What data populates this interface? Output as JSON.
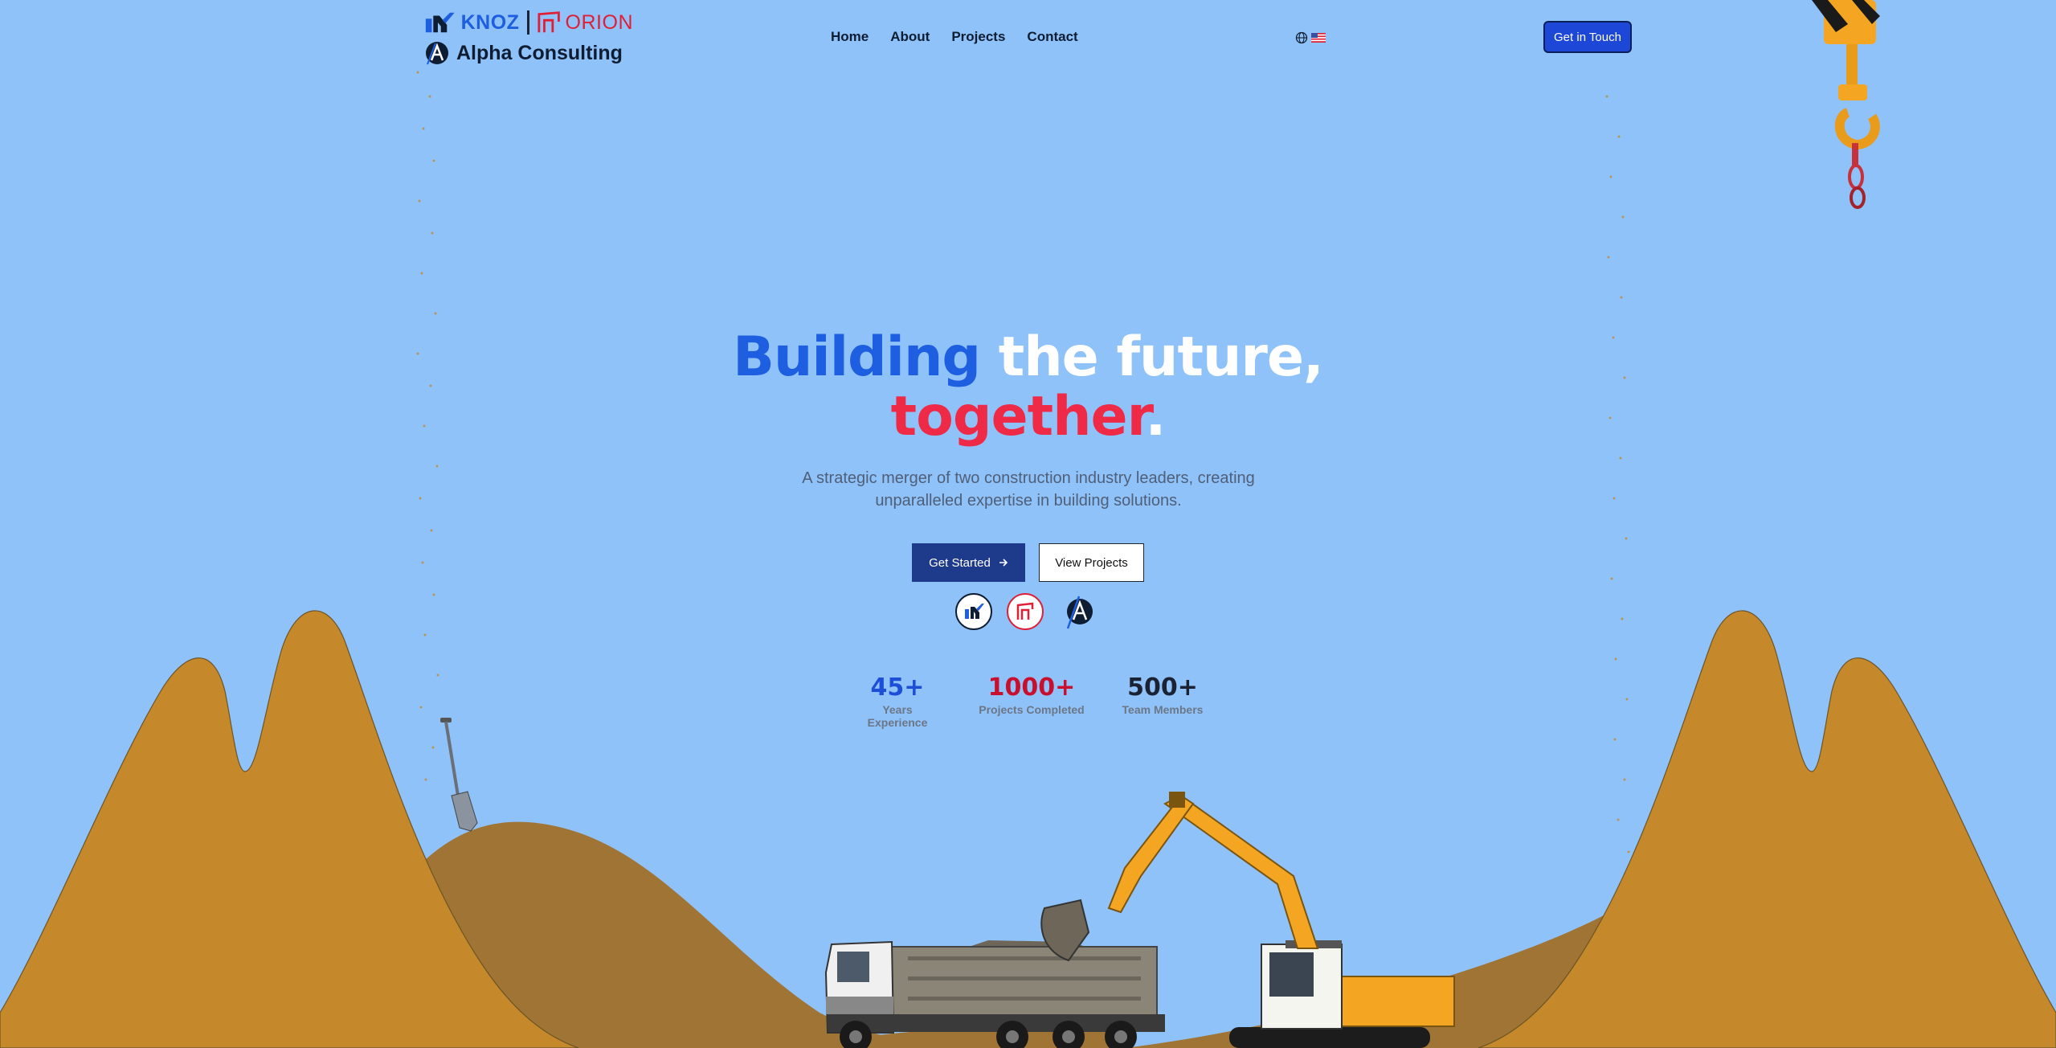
{
  "brand": {
    "knoz": "KNOZ",
    "orion": "ORION",
    "alpha": "Alpha Consulting"
  },
  "nav": {
    "items": [
      "Home",
      "About",
      "Projects",
      "Contact"
    ]
  },
  "header": {
    "cta_label": "Get in Touch",
    "language_icon": "globe-icon",
    "language_flag": "us-flag-icon"
  },
  "hero": {
    "title_part1": "Building",
    "title_part2": " the future,",
    "title_part3": "together",
    "title_part4": ".",
    "subtitle": "A strategic merger of two construction industry leaders, creating unparalleled expertise in building solutions.",
    "primary_button": "Get Started",
    "secondary_button": "View Projects"
  },
  "stats": [
    {
      "value": "45+",
      "label": "Years Experience",
      "color": "#1d4ed8"
    },
    {
      "value": "1000+",
      "label": "Projects Completed",
      "color": "#c8102e"
    },
    {
      "value": "500+",
      "label": "Team Members",
      "color": "#1b2233"
    }
  ],
  "colors": {
    "background": "#90c2fa",
    "blue": "#1d5fe0",
    "red": "#ee2a47",
    "dirt": "#c5892b",
    "dirt_dark": "#a07434",
    "navy": "#1e3a8a"
  }
}
